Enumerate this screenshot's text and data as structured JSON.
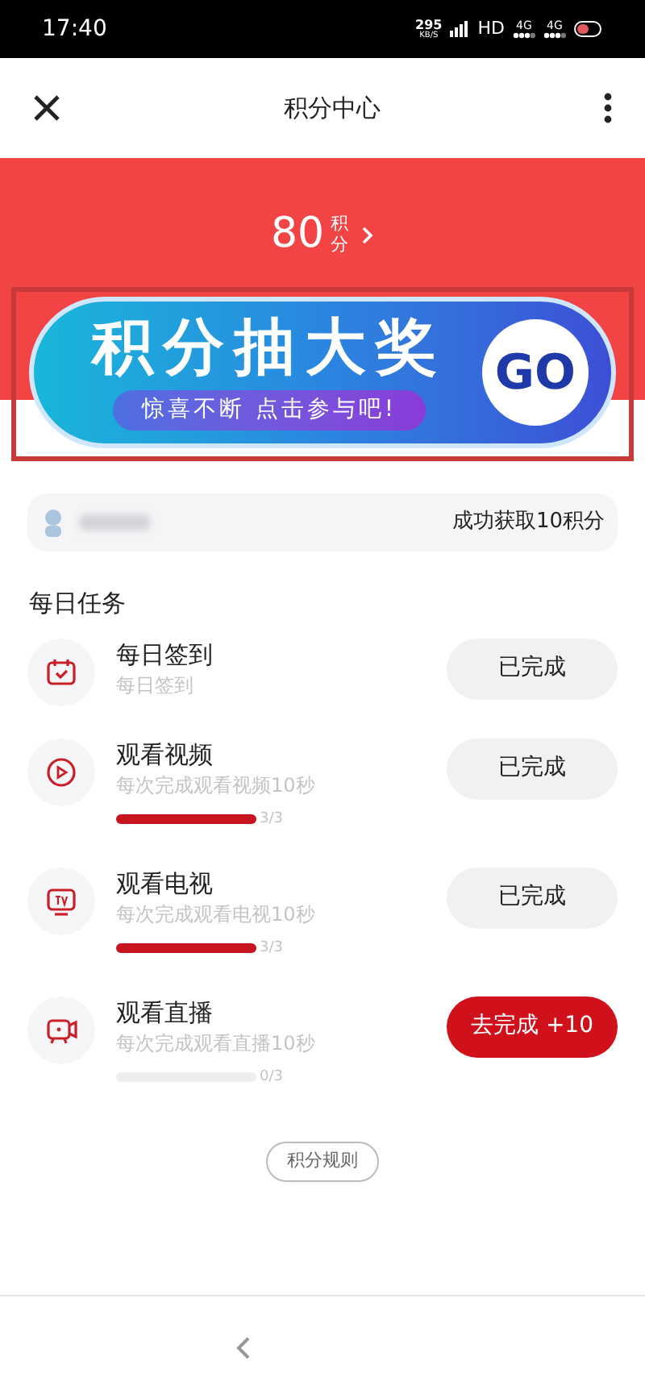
{
  "status_bar": {
    "time": "17:40",
    "net_speed": "295",
    "net_unit": "KB/S",
    "hd": "HD",
    "networks": [
      "4G",
      "4G"
    ]
  },
  "header": {
    "title": "积分中心"
  },
  "points": {
    "value": "80",
    "unit": "积分"
  },
  "banner": {
    "title": "积分抽大奖",
    "subtitle": "惊喜不断 点击参与吧!",
    "go": "GO"
  },
  "notice": {
    "text": "成功获取10积分"
  },
  "section_title": "每日任务",
  "tasks": [
    {
      "kind": "calendar",
      "name": "每日签到",
      "desc": "每日签到",
      "button": {
        "label": "已完成",
        "done": true
      }
    },
    {
      "kind": "play",
      "name": "观看视频",
      "desc": "每次完成观看视频10秒",
      "progress": {
        "level": 1,
        "reading": "3/3"
      },
      "button": {
        "label": "已完成",
        "done": true
      }
    },
    {
      "kind": "tv",
      "name": "观看电视",
      "desc": "每次完成观看电视10秒",
      "progress": {
        "level": 1,
        "reading": "3/3"
      },
      "button": {
        "label": "已完成",
        "done": true
      }
    },
    {
      "kind": "camera",
      "name": "观看直播",
      "desc": "每次完成观看直播10秒",
      "progress": {
        "level": 0,
        "reading": "0/3"
      },
      "button": {
        "label": "去完成 +10",
        "done": false
      }
    }
  ],
  "rules_button": "积分规则"
}
